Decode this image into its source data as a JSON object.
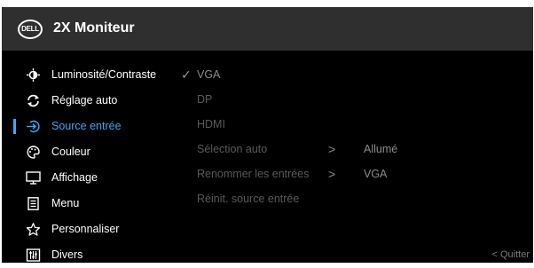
{
  "header": {
    "logo_text": "DELL",
    "title": "2X Moniteur"
  },
  "nav": {
    "items": [
      {
        "label": "Luminosité/Contraste",
        "icon": "brightness-icon"
      },
      {
        "label": "Réglage auto",
        "icon": "auto-adjust-icon"
      },
      {
        "label": "Source entrée",
        "icon": "input-source-icon",
        "active": true
      },
      {
        "label": "Couleur",
        "icon": "palette-icon"
      },
      {
        "label": "Affichage",
        "icon": "monitor-icon"
      },
      {
        "label": "Menu",
        "icon": "menu-document-icon"
      },
      {
        "label": "Personnaliser",
        "icon": "star-icon"
      },
      {
        "label": "Divers",
        "icon": "sliders-icon"
      }
    ]
  },
  "options": {
    "rows": [
      {
        "label": "VGA",
        "checked": true
      },
      {
        "label": "DP"
      },
      {
        "label": "HDMI"
      },
      {
        "label": "Sélection auto",
        "arrow": ">",
        "value": "Allumé"
      },
      {
        "label": "Renommer les entrées",
        "arrow": ">",
        "value": "VGA"
      },
      {
        "label": "Réinit. source entrée"
      }
    ]
  },
  "footer": {
    "quit_label": "< Quitter"
  },
  "colors": {
    "accent": "#41a6f5",
    "background": "#000000",
    "header": "#2f2f2f"
  }
}
